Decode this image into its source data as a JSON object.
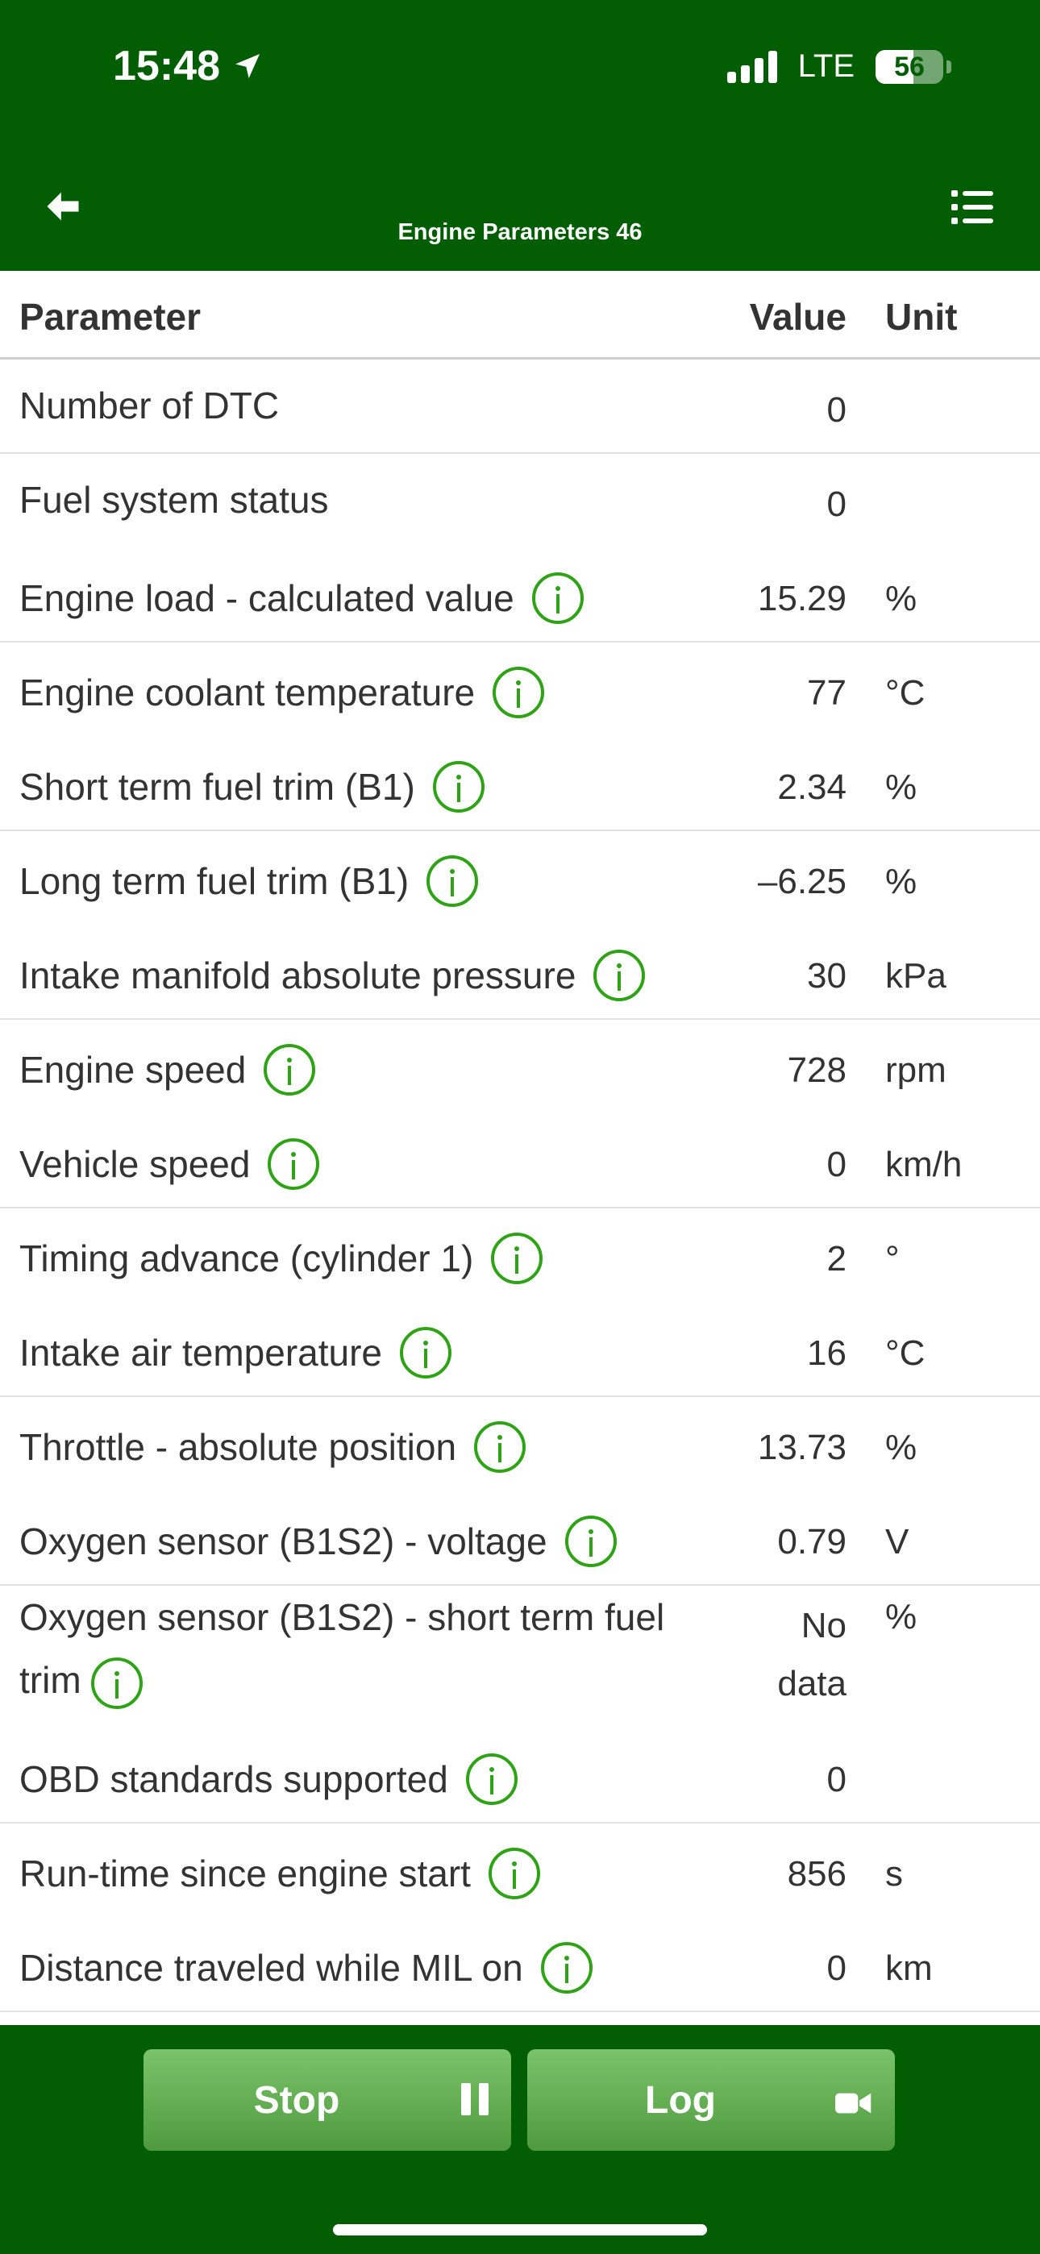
{
  "status_bar": {
    "time": "15:48",
    "network": "LTE",
    "battery": "56",
    "battery_level": 0.56
  },
  "nav": {
    "title": "Engine Parameters 46",
    "back_icon": "arrow-left-icon",
    "menu_icon": "list-icon"
  },
  "table": {
    "columns": {
      "parameter": "Parameter",
      "value": "Value",
      "unit": "Unit"
    },
    "rows": [
      {
        "parameter": "Number of DTC",
        "value": "0",
        "unit": "",
        "info": false
      },
      {
        "parameter": "Fuel system status",
        "value": "0",
        "unit": "",
        "info": false
      },
      {
        "parameter": "Engine load - calculated value",
        "value": "15.29",
        "unit": "%",
        "info": true
      },
      {
        "parameter": "Engine coolant temperature",
        "value": "77",
        "unit": "°C",
        "info": true
      },
      {
        "parameter": "Short term fuel trim (B1)",
        "value": "2.34",
        "unit": "%",
        "info": true
      },
      {
        "parameter": "Long term fuel trim (B1)",
        "value": "–6.25",
        "unit": "%",
        "info": true
      },
      {
        "parameter": "Intake manifold absolute pressure",
        "value": "30",
        "unit": "kPa",
        "info": true
      },
      {
        "parameter": "Engine speed",
        "value": "728",
        "unit": "rpm",
        "info": true
      },
      {
        "parameter": "Vehicle speed",
        "value": "0",
        "unit": "km/h",
        "info": true
      },
      {
        "parameter": "Timing advance (cylinder 1)",
        "value": "2",
        "unit": "°",
        "info": true
      },
      {
        "parameter": "Intake air temperature",
        "value": "16",
        "unit": "°C",
        "info": true
      },
      {
        "parameter": "Throttle - absolute position",
        "value": "13.73",
        "unit": "%",
        "info": true
      },
      {
        "parameter": "Oxygen sensor (B1S2) - voltage",
        "value": "0.79",
        "unit": "V",
        "info": true
      },
      {
        "parameter": "Oxygen sensor (B1S2) - short term fuel trim",
        "value": "No data",
        "unit": "%",
        "info": true
      },
      {
        "parameter": "OBD standards supported",
        "value": "0",
        "unit": "",
        "info": true
      },
      {
        "parameter": "Run-time since engine start",
        "value": "856",
        "unit": "s",
        "info": true
      },
      {
        "parameter": "Distance traveled while MIL on",
        "value": "0",
        "unit": "km",
        "info": true
      }
    ]
  },
  "footer": {
    "stop_label": "Stop",
    "log_label": "Log",
    "stop_icon": "pause-icon",
    "log_icon": "video-camera-icon"
  },
  "colors": {
    "header_bg": "#035e03",
    "info_icon": "#2ea316",
    "button_top": "#7bc36a",
    "button_bottom": "#4f9a3f"
  }
}
